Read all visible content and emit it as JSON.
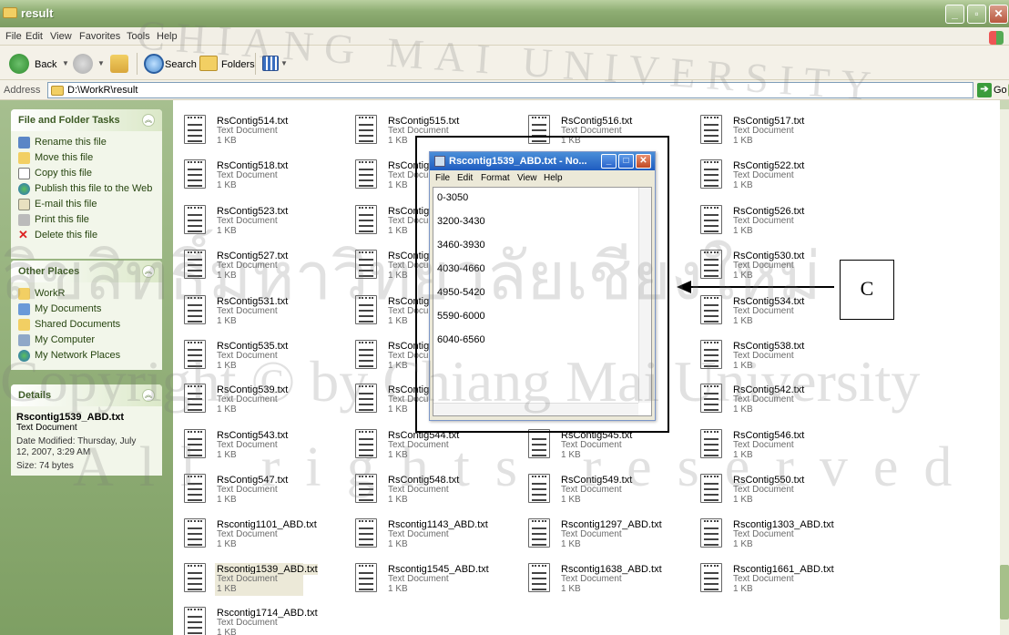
{
  "window": {
    "title": "result"
  },
  "menu": [
    "File",
    "Edit",
    "View",
    "Favorites",
    "Tools",
    "Help"
  ],
  "toolbar": {
    "back": "Back",
    "search": "Search",
    "folders": "Folders"
  },
  "address": {
    "label": "Address",
    "value": "D:\\WorkR\\result",
    "go": "Go"
  },
  "panels": {
    "tasks": {
      "title": "File and Folder Tasks",
      "items": [
        "Rename this file",
        "Move this file",
        "Copy this file",
        "Publish this file to the Web",
        "E-mail this file",
        "Print this file",
        "Delete this file"
      ]
    },
    "places": {
      "title": "Other Places",
      "items": [
        "WorkR",
        "My Documents",
        "Shared Documents",
        "My Computer",
        "My Network Places"
      ]
    },
    "details": {
      "title": "Details",
      "filename": "Rscontig1539_ABD.txt",
      "type": "Text Document",
      "modified_1": "Date Modified: Thursday, July",
      "modified_2": "12, 2007, 3:29 AM",
      "size": "Size: 74 bytes"
    }
  },
  "files": {
    "type": "Text Document",
    "size": "1 KB",
    "rows": [
      [
        "RsContig514.txt",
        "RsContig515.txt",
        "RsContig516.txt",
        "RsContig517.txt"
      ],
      [
        "RsContig518.txt",
        "RsContig5",
        "",
        "RsContig522.txt"
      ],
      [
        "RsContig523.txt",
        "RsContig5",
        "",
        "RsContig526.txt"
      ],
      [
        "RsContig527.txt",
        "RsContig5",
        "",
        "RsContig530.txt"
      ],
      [
        "RsContig531.txt",
        "RsContig5",
        "",
        "RsContig534.txt"
      ],
      [
        "RsContig535.txt",
        "RsContig5",
        "",
        "RsContig538.txt"
      ],
      [
        "RsContig539.txt",
        "RsContig5",
        "",
        "RsContig542.txt"
      ],
      [
        "RsContig543.txt",
        "RsContig544.txt",
        "RsContig545.txt",
        "RsContig546.txt"
      ],
      [
        "RsContig547.txt",
        "RsContig548.txt",
        "RsContig549.txt",
        "RsContig550.txt"
      ],
      [
        "Rscontig1101_ABD.txt",
        "Rscontig1143_ABD.txt",
        "Rscontig1297_ABD.txt",
        "Rscontig1303_ABD.txt"
      ],
      [
        "Rscontig1539_ABD.txt",
        "Rscontig1545_ABD.txt",
        "Rscontig1638_ABD.txt",
        "Rscontig1661_ABD.txt"
      ],
      [
        "Rscontig1714_ABD.txt",
        "",
        "",
        ""
      ]
    ]
  },
  "notepad": {
    "title": "Rscontig1539_ABD.txt - No...",
    "menu": [
      "File",
      "Edit",
      "Format",
      "View",
      "Help"
    ],
    "lines": [
      "0-3050",
      "3200-3430",
      "3460-3930",
      "4030-4660",
      "4950-5420",
      "5590-6000",
      "6040-6560"
    ]
  },
  "annotation": {
    "label": "C"
  },
  "watermark": {
    "line1": "ลิขสิทธิ์มหาวิทยาลัยเชียงใหม่",
    "line2": "Copyright © by Chiang Mai University",
    "line3": "All rights reserved",
    "arc": "CHIANG MAI UNIVERSITY"
  }
}
